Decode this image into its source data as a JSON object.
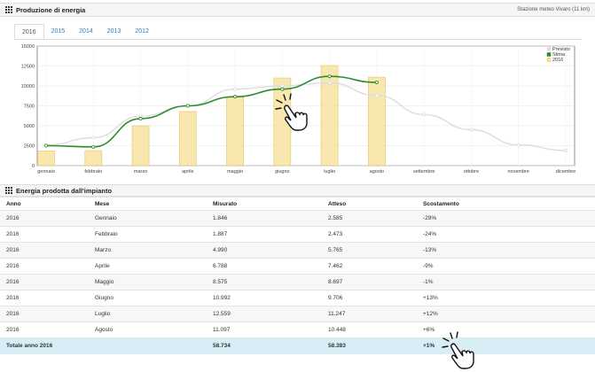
{
  "header": {
    "title": "Produzione di energia",
    "station": "Stazione meteo Vivaro (11 km)"
  },
  "tabs": [
    "2016",
    "2015",
    "2014",
    "2013",
    "2012"
  ],
  "active_tab": 0,
  "chart_data": {
    "type": "bar",
    "categories": [
      "gennaio",
      "febbraio",
      "marzo",
      "aprile",
      "maggio",
      "giugno",
      "luglio",
      "agosto",
      "settembre",
      "ottobre",
      "novembre",
      "dicembre"
    ],
    "ylim": [
      0,
      15000
    ],
    "yticks": [
      "0",
      "2500",
      "5000",
      "7500",
      "10000",
      "12500",
      "15000"
    ],
    "series": [
      {
        "name": "Previsto",
        "type": "line",
        "color": "#dddddd",
        "values": [
          2585,
          3500,
          6200,
          7500,
          9600,
          10000,
          10400,
          8800,
          6400,
          4500,
          2600,
          1900
        ]
      },
      {
        "name": "Stima",
        "type": "line",
        "color": "#2e8b2e",
        "values": [
          2500,
          2350,
          5900,
          7500,
          8650,
          9600,
          11200,
          10448,
          null,
          null,
          null,
          null
        ]
      },
      {
        "name": "2016",
        "type": "bar",
        "color": "#f7e3a0",
        "values": [
          1846,
          1887,
          4990,
          6788,
          8575,
          10992,
          12559,
          11097,
          null,
          null,
          null,
          null
        ]
      }
    ]
  },
  "table": {
    "title": "Energia prodotta dall'impianto",
    "headers": [
      "Anno",
      "Mese",
      "Misurato",
      "Atteso",
      "Scostamento"
    ],
    "rows": [
      [
        "2016",
        "Gennaio",
        "1.846",
        "2.585",
        "-29%"
      ],
      [
        "2016",
        "Febbraio",
        "1.887",
        "2.473",
        "-24%"
      ],
      [
        "2016",
        "Marzo",
        "4.990",
        "5.765",
        "-13%"
      ],
      [
        "2016",
        "Aprile",
        "6.788",
        "7.462",
        "-9%"
      ],
      [
        "2016",
        "Maggio",
        "8.575",
        "8.697",
        "-1%"
      ],
      [
        "2016",
        "Giugno",
        "10.992",
        "9.706",
        "+13%"
      ],
      [
        "2016",
        "Luglio",
        "12.559",
        "11.247",
        "+12%"
      ],
      [
        "2016",
        "Agosto",
        "11.097",
        "10.448",
        "+6%"
      ]
    ],
    "total": [
      "Totale anno 2016",
      "",
      "58.734",
      "58.383",
      "+1%"
    ]
  },
  "icons": [
    "grid-icon",
    "pointer-hand-icon"
  ]
}
